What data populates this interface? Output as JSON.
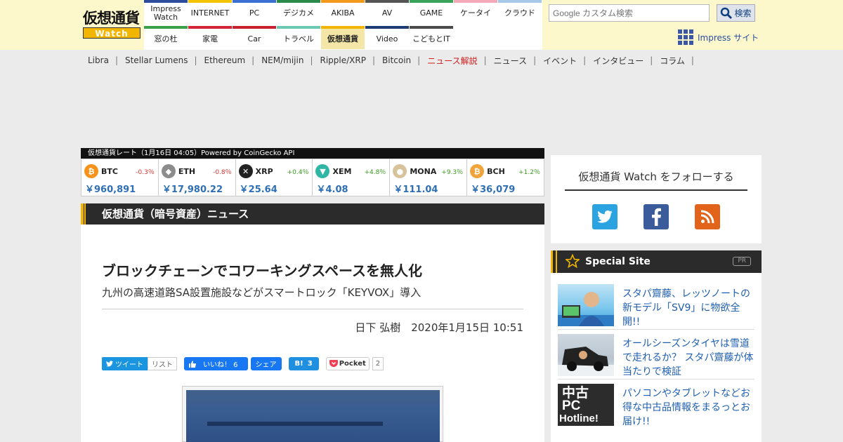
{
  "header": {
    "logo": {
      "top": "仮想通貨",
      "bottom": "Watch"
    },
    "nav": [
      {
        "label": "Impress Watch",
        "color": "#2b4d9b"
      },
      {
        "label": "INTERNET",
        "color": "#f5c400"
      },
      {
        "label": "PC",
        "color": "#3b6fd2"
      },
      {
        "label": "デジカメ",
        "color": "#2a8a4a"
      },
      {
        "label": "AKIBA",
        "color": "#f39a1d"
      },
      {
        "label": "AV",
        "color": "#555555"
      },
      {
        "label": "GAME",
        "color": "#3aa35a"
      },
      {
        "label": "ケータイ",
        "color": "#f4a9b8"
      },
      {
        "label": "クラウド",
        "color": "#a8c8ea"
      },
      {
        "label": "窓の杜",
        "color": "#3aa04a"
      },
      {
        "label": "家電",
        "color": "#d4243a"
      },
      {
        "label": "Car",
        "color": "#c8202e"
      },
      {
        "label": "トラベル",
        "color": "#6cc6b4"
      },
      {
        "label": "仮想通貨",
        "color": "#f2b600",
        "active": true
      },
      {
        "label": "Video",
        "color": "#1e3b73"
      },
      {
        "label": "こどもとIT",
        "color": "#4a4a4a"
      }
    ],
    "search": {
      "placeholder": "カスタム検索",
      "google": "Google",
      "button": "検索"
    },
    "impress_link": "Impress サイト"
  },
  "subnav": [
    {
      "label": "Libra"
    },
    {
      "label": "Stellar Lumens"
    },
    {
      "label": "Ethereum"
    },
    {
      "label": "NEM/mijin"
    },
    {
      "label": "Ripple/XRP"
    },
    {
      "label": "Bitcoin"
    },
    {
      "label": "ニュース解説",
      "highlight": true
    },
    {
      "label": "ニュース"
    },
    {
      "label": "イベント"
    },
    {
      "label": "インタビュー"
    },
    {
      "label": "コラム"
    }
  ],
  "rates": {
    "header": "仮想通貨レート（1月16日 04:05）Powered by CoinGecko API",
    "coins": [
      {
        "symbol": "BTC",
        "change": "-0.3％",
        "price": "￥960,891",
        "dir": "neg",
        "color": "#f7931a",
        "glyph": "₿"
      },
      {
        "symbol": "ETH",
        "change": "-0.8％",
        "price": "￥17,980.22",
        "dir": "neg",
        "color": "#8c8c8c",
        "glyph": "◆"
      },
      {
        "symbol": "XRP",
        "change": "+0.4％",
        "price": "￥25.64",
        "dir": "pos",
        "color": "#222222",
        "glyph": "✕"
      },
      {
        "symbol": "XEM",
        "change": "+4.8％",
        "price": "￥4.08",
        "dir": "pos",
        "color": "#2fb6a4",
        "glyph": "▼"
      },
      {
        "symbol": "MONA",
        "change": "+9.3％",
        "price": "￥111.04",
        "dir": "pos",
        "color": "#d8c29a",
        "glyph": "●"
      },
      {
        "symbol": "BCH",
        "change": "+1.2％",
        "price": "￥36,079",
        "dir": "pos",
        "color": "#f2a33a",
        "glyph": "₿"
      }
    ]
  },
  "section": {
    "title": "仮想通貨（暗号資産）ニュース"
  },
  "article": {
    "title": "ブロックチェーンでコワーキングスペースを無人化",
    "subtitle": "九州の高速道路SA設置施設などがスマートロック「KEYVOX」導入",
    "byline": "日下 弘樹　2020年1月15日 10:51"
  },
  "share": {
    "tweet": "ツイート",
    "list": "リスト",
    "like": "いいね！ 6",
    "fb_share": "シェア",
    "hatena": "B!",
    "hatena_count": "3",
    "pocket": "Pocket",
    "pocket_count": "2"
  },
  "follow": {
    "title": "仮想通貨 Watch をフォローする"
  },
  "special": {
    "title": "Special Site",
    "pr": "PR",
    "items": [
      {
        "text": "スタパ齋藤、レッツノートの新モデル「SV9」に物欲全開!!"
      },
      {
        "text": "オールシーズンタイヤは雪道で走れるか？ スタパ齋藤が体当たりで検証"
      },
      {
        "text": "パソコンやタブレットなどお得な中古品情報をまるっとお届け!!",
        "thumb": {
          "line1": "中古",
          "line2": "PC",
          "line3": "Hotline!"
        }
      }
    ]
  }
}
